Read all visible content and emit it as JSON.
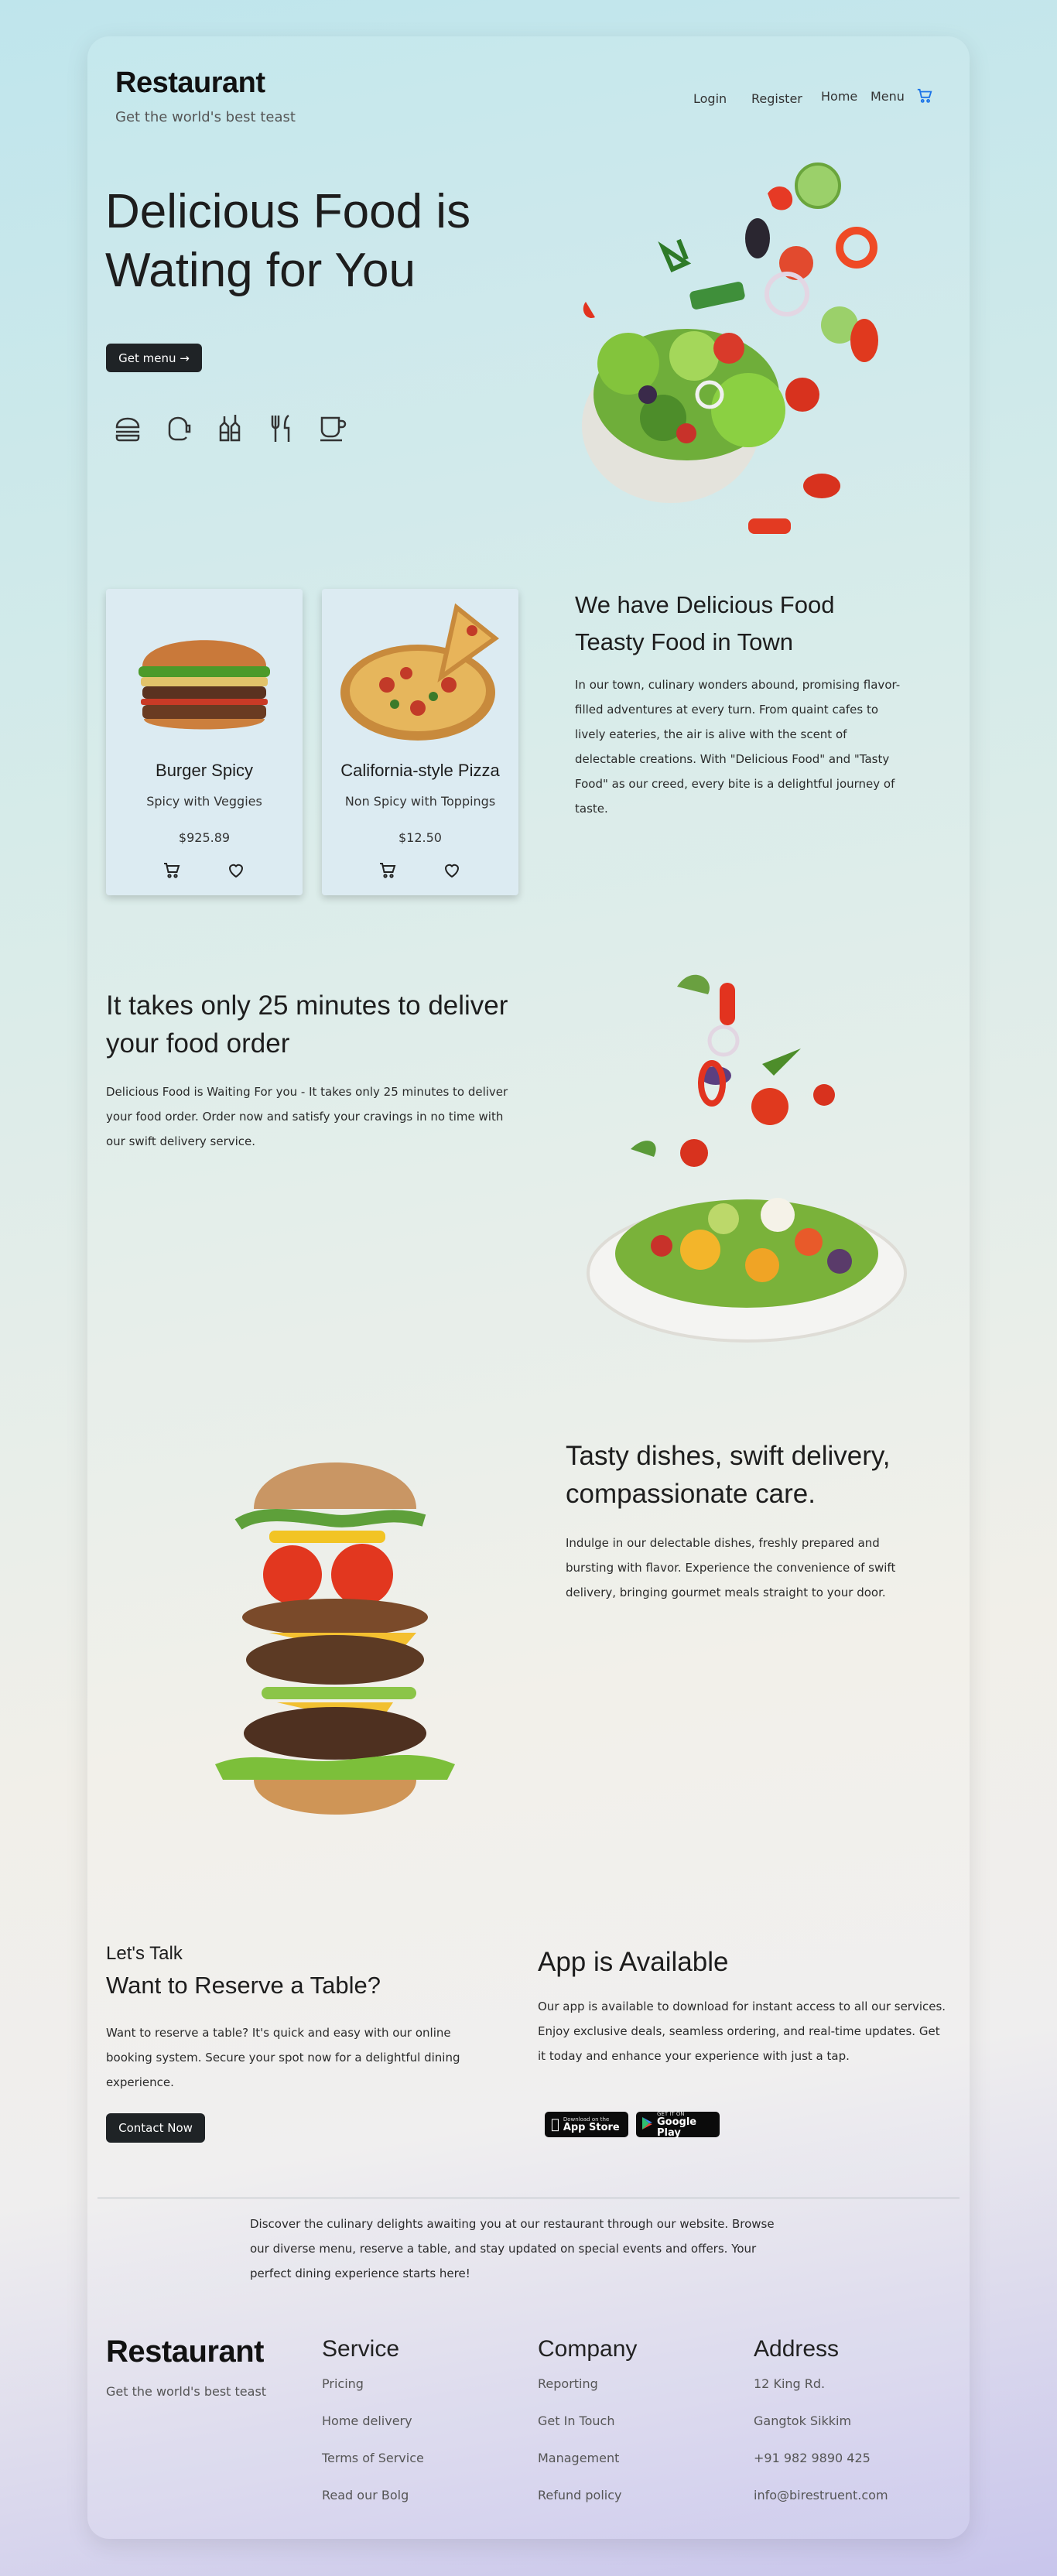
{
  "header": {
    "brand": "Restaurant",
    "tagline": "Get the world's best teast",
    "nav": {
      "login": "Login",
      "register": "Register",
      "home": "Home",
      "menu": "Menu"
    },
    "cart_icon": "cart-icon"
  },
  "hero": {
    "title_line1": "Delicious Food is",
    "title_line2": "Wating for You",
    "cta": "Get menu →",
    "category_icons": [
      "burger-icon",
      "cake-icon",
      "bottles-icon",
      "cutlery-icon",
      "coffee-cup-icon"
    ]
  },
  "products": [
    {
      "name": "Burger Spicy",
      "desc": "Spicy with Veggies",
      "price": "$925.89"
    },
    {
      "name": "California-style Pizza",
      "desc": "Non Spicy with Toppings",
      "price": "$12.50"
    }
  ],
  "about": {
    "title_line1": "We have Delicious Food",
    "title_line2": "Teasty Food in Town",
    "text": "In our town, culinary wonders abound, promising flavor-filled adventures at every turn. From quaint cafes to lively eateries, the air is alive with the scent of delectable creations. With \"Delicious Food\" and \"Tasty Food\" as our creed, every bite is a delightful journey of taste."
  },
  "delivery": {
    "title": "It takes only 25 minutes to deliver your food order",
    "text": "Delicious Food is Waiting For you - It takes only 25 minutes to deliver your food order. Order now and satisfy your cravings in no time with our swift delivery service."
  },
  "dishes": {
    "title": "Tasty dishes, swift delivery, compassionate care.",
    "text": "Indulge in our delectable dishes, freshly prepared and bursting with flavor. Experience the convenience of swift delivery, bringing gourmet meals straight to your door."
  },
  "reserve": {
    "eyebrow": "Let's Talk",
    "title": "Want to Reserve a Table?",
    "text": "Want to reserve a table? It's quick and easy with our online booking system. Secure your spot now for a delightful dining experience.",
    "cta": "Contact Now"
  },
  "app": {
    "title": "App is Available",
    "text": "Our app is available to download for instant access to all our services. Enjoy exclusive deals, seamless ordering, and real-time updates. Get it today and enhance your experience with just a tap.",
    "appstore_small": "Download on the",
    "appstore_big": "App Store",
    "play_small": "GET IT ON",
    "play_big": "Google Play"
  },
  "footer_blurb": "Discover the culinary delights awaiting you at our restaurant through our website. Browse our diverse menu, reserve a table, and stay updated on special events and offers. Your perfect dining experience starts here!",
  "footer": {
    "brand": "Restaurant",
    "tagline": "Get the world's best teast",
    "service": {
      "title": "Service",
      "links": [
        "Pricing",
        "Home delivery",
        "Terms of Service",
        "Read our Bolg"
      ]
    },
    "company": {
      "title": "Company",
      "links": [
        "Reporting",
        "Get In Touch",
        "Management",
        "Refund policy"
      ]
    },
    "address": {
      "title": "Address",
      "lines": [
        "12 King Rd.",
        "Gangtok Sikkim",
        "+91 982 9890 425",
        "info@birestruent.com"
      ]
    }
  },
  "colors": {
    "button": "#1f2326",
    "card_bg": "#dcebf2",
    "cart": "#1a73e8"
  }
}
